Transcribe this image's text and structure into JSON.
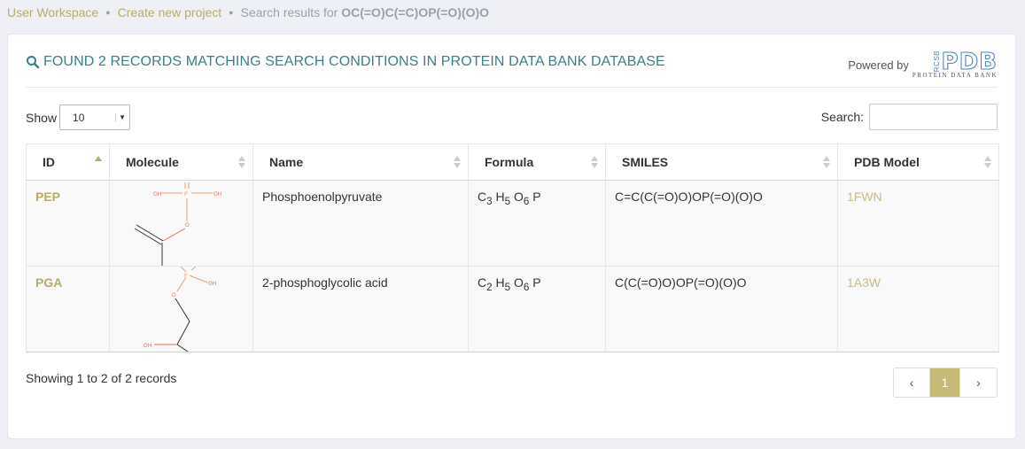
{
  "breadcrumb": {
    "items": [
      "User Workspace",
      "Create new project"
    ],
    "current_prefix": "Search results for ",
    "current_query": "OC(=O)C(=C)OP(=O)(O)O"
  },
  "panel": {
    "title": "FOUND 2 RECORDS MATCHING SEARCH CONDITIONS IN PROTEIN DATA BANK DATABASE",
    "title_icon": "search-icon",
    "powered_by": "Powered by",
    "logo": {
      "rcsb": "RCSB",
      "main": "PDB",
      "sub": "PROTEIN DATA BANK"
    }
  },
  "length": {
    "label": "Show",
    "value": "10"
  },
  "search": {
    "label": "Search:",
    "value": "",
    "placeholder": ""
  },
  "table": {
    "columns": [
      "ID",
      "Molecule",
      "Name",
      "Formula",
      "SMILES",
      "PDB Model"
    ],
    "sorted_column": "ID",
    "rows": [
      {
        "id": "PEP",
        "name": "Phosphoenolpyruvate",
        "formula": [
          [
            "C",
            "3"
          ],
          [
            "H",
            "5"
          ],
          [
            "O",
            "6"
          ],
          [
            "P",
            ""
          ]
        ],
        "smiles": "C=C(C(=O)O)OP(=O)(O)O",
        "pdb_model": "1FWN",
        "mol_labels": [
          "OH",
          "P",
          "OH",
          "O"
        ]
      },
      {
        "id": "PGA",
        "name": "2-phosphoglycolic acid",
        "formula": [
          [
            "C",
            "2"
          ],
          [
            "H",
            "5"
          ],
          [
            "O",
            "6"
          ],
          [
            "P",
            ""
          ]
        ],
        "smiles": "C(C(=O)O)OP(=O)(O)O",
        "pdb_model": "1A3W",
        "mol_labels": [
          "P",
          "OH",
          "O",
          "OH"
        ]
      }
    ]
  },
  "footer": {
    "info": "Showing 1 to 2 of 2 records",
    "pager": {
      "prev": "‹",
      "current": "1",
      "next": "›"
    }
  },
  "colors": {
    "accent_teal": "#3d7f86",
    "accent_gold": "#b8ab6a",
    "active_page": "#c7ba77"
  }
}
